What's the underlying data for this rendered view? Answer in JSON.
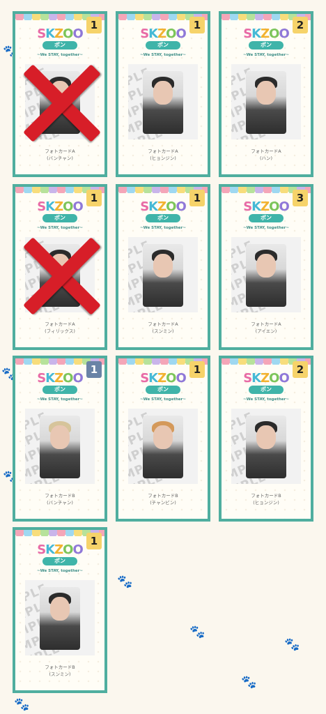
{
  "logo": {
    "title_parts": [
      "S",
      "K",
      "Z",
      "O",
      "O"
    ],
    "ribbon": "ポン",
    "tagline": "~We STAY, together~"
  },
  "watermark": "SAMPLE",
  "cards": [
    {
      "count": "1",
      "label": "フォトカードA",
      "member": "(バンチャン)",
      "crossed": true,
      "badge_style": "yellow",
      "hair": "dark"
    },
    {
      "count": "1",
      "label": "フォトカードA",
      "member": "(ヒョンジン)",
      "crossed": false,
      "badge_style": "yellow",
      "hair": "dark"
    },
    {
      "count": "2",
      "label": "フォトカードA",
      "member": "(ハン)",
      "crossed": false,
      "badge_style": "yellow",
      "hair": "dark"
    },
    {
      "count": "1",
      "label": "フォトカードA",
      "member": "(フィリックス)",
      "crossed": true,
      "badge_style": "yellow",
      "hair": "dark"
    },
    {
      "count": "1",
      "label": "フォトカードA",
      "member": "(スンミン)",
      "crossed": false,
      "badge_style": "yellow",
      "hair": "dark"
    },
    {
      "count": "3",
      "label": "フォトカードA",
      "member": "(アイエン)",
      "crossed": false,
      "badge_style": "yellow",
      "hair": "dark"
    },
    {
      "count": "1",
      "label": "フォトカードB",
      "member": "(バンチャン)",
      "crossed": false,
      "badge_style": "blue",
      "hair": "blond"
    },
    {
      "count": "1",
      "label": "フォトカードB",
      "member": "(チャンビン)",
      "crossed": false,
      "badge_style": "yellow",
      "hair": "orange"
    },
    {
      "count": "2",
      "label": "フォトカードB",
      "member": "(ヒョンジン)",
      "crossed": false,
      "badge_style": "yellow",
      "hair": "dark"
    },
    {
      "count": "1",
      "label": "フォトカードB",
      "member": "(スンミン)",
      "crossed": false,
      "badge_style": "yellow",
      "hair": "dark"
    }
  ]
}
